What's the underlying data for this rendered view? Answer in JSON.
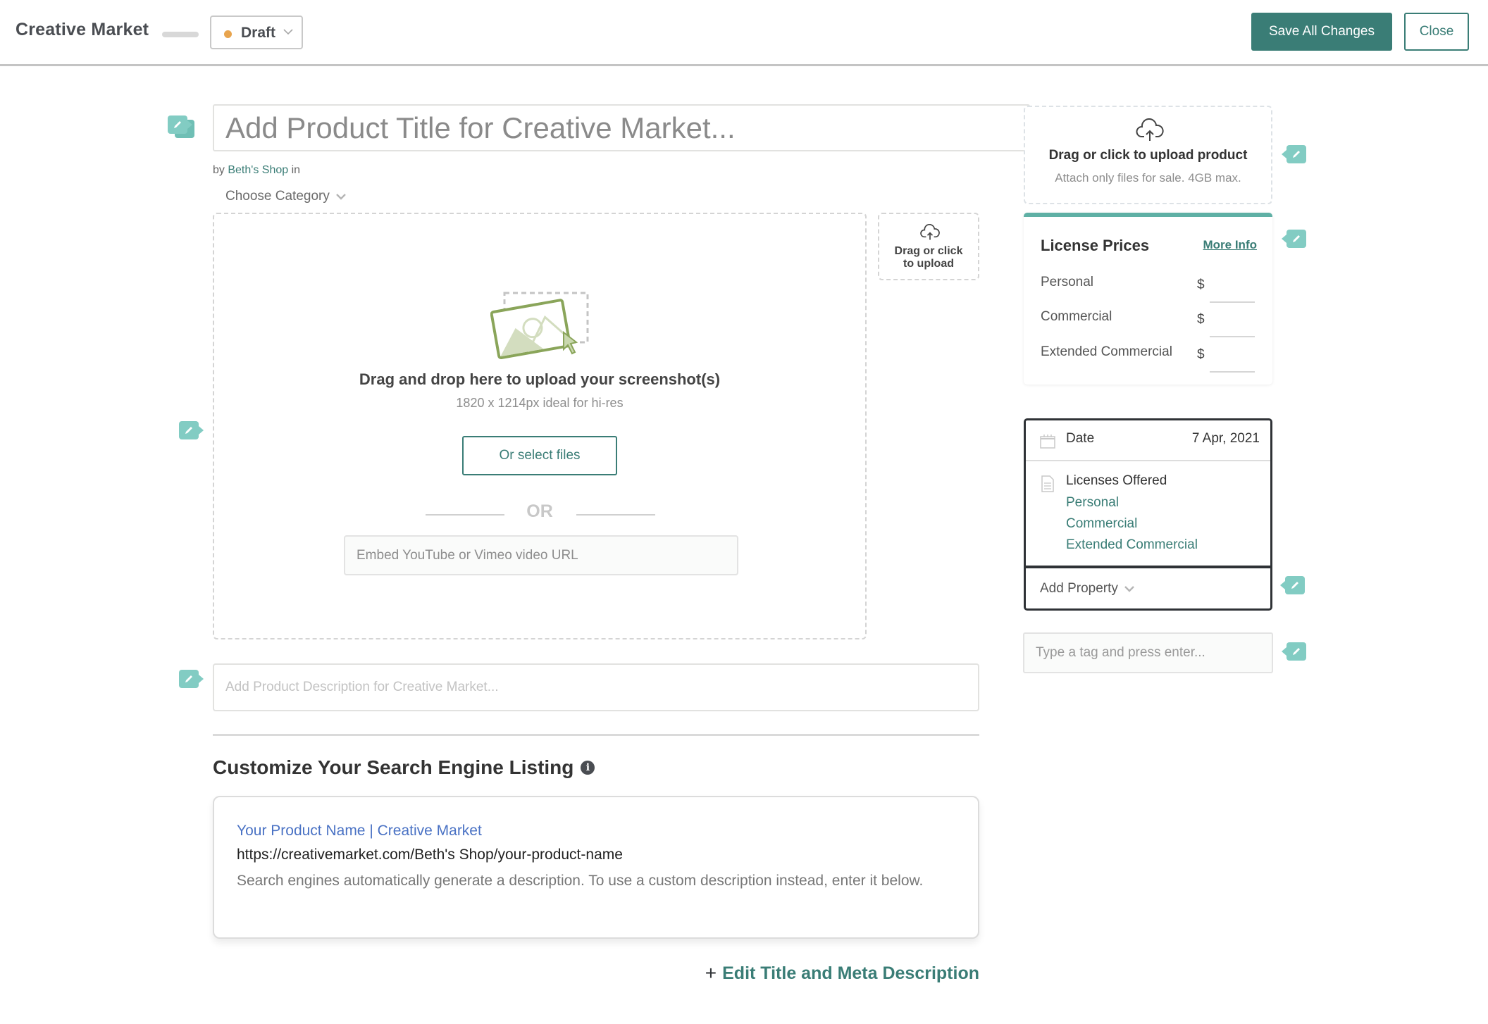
{
  "header": {
    "app_title": "Creative Market",
    "status": {
      "label": "Draft",
      "dot_color": "#e8a44e"
    },
    "save_label": "Save All Changes",
    "close_label": "Close"
  },
  "product": {
    "title_placeholder": "Add Product Title for Creative Market...",
    "by_prefix": "by",
    "shop_name": "Beth's Shop",
    "by_suffix": "in",
    "category_label": "Choose Category"
  },
  "product_upload": {
    "title": "Drag or click to upload product",
    "subtitle": "Attach only files for sale. 4GB max."
  },
  "license_prices": {
    "title": "License Prices",
    "more_info": "More Info",
    "currency": "$",
    "rows": [
      {
        "label": "Personal",
        "value": ""
      },
      {
        "label": "Commercial",
        "value": ""
      },
      {
        "label": "Extended Commercial",
        "value": ""
      }
    ]
  },
  "properties": {
    "date_label": "Date",
    "date_value": "7 Apr, 2021",
    "licenses_label": "Licenses Offered",
    "licenses": [
      "Personal",
      "Commercial",
      "Extended Commercial"
    ],
    "add_property": "Add Property"
  },
  "tags": {
    "placeholder": "Type a tag and press enter..."
  },
  "screenshots": {
    "title": "Drag and drop here to upload your screenshot(s)",
    "subtitle": "1820 x 1214px ideal for hi-res",
    "select_label": "Or select files",
    "or_label": "OR",
    "embed_placeholder": "Embed YouTube or Vimeo video URL"
  },
  "small_upload": {
    "line1": "Drag or click",
    "line2": "to upload"
  },
  "description": {
    "placeholder": "Add Product Description for Creative Market..."
  },
  "seo": {
    "heading": "Customize Your Search Engine Listing",
    "preview_title": "Your Product Name | Creative Market",
    "preview_url": "https://creativemarket.com/Beth's Shop/your-product-name",
    "preview_desc": "Search engines automatically generate a description. To use a custom description instead, enter it below.",
    "edit_label": "Edit Title and Meta Description"
  },
  "colors": {
    "accent": "#3a7d76",
    "edit_tag": "#82ccc3",
    "license_bar": "#5fb0a5",
    "seo_link": "#4a72c4"
  }
}
